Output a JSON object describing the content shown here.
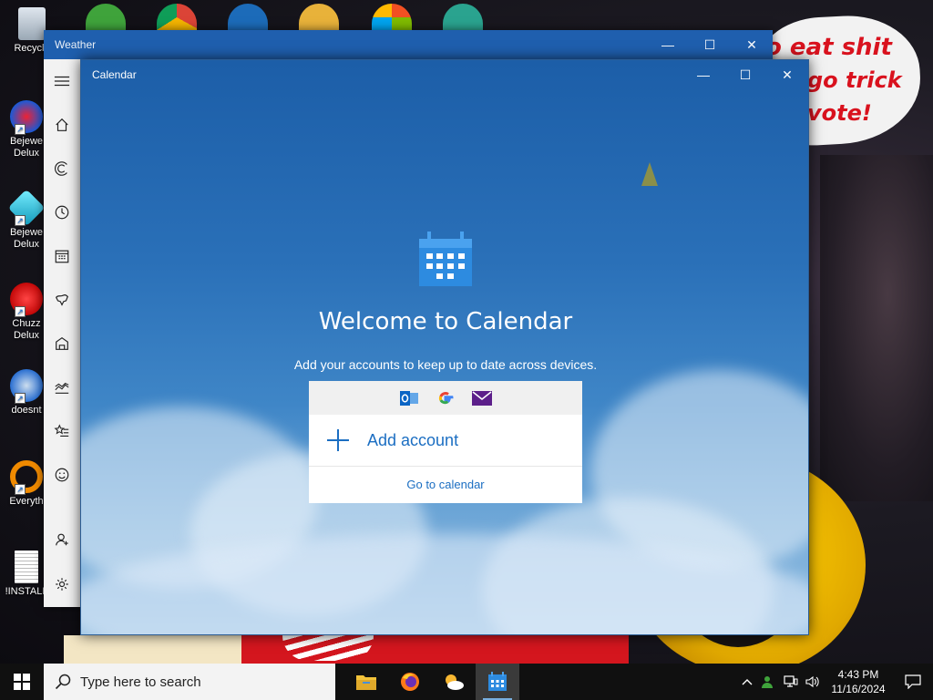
{
  "desktop": {
    "icons": [
      {
        "label": "Recycle"
      },
      {
        "label": "Bejewe Delux"
      },
      {
        "label": "Bejewe Delux"
      },
      {
        "label": "Chuzz Delux"
      },
      {
        "label": "doesnt"
      },
      {
        "label": "Everyth"
      },
      {
        "label": "!INSTALL"
      }
    ],
    "wallpaper_text": [
      "o eat shit",
      "go trick",
      "vote!"
    ]
  },
  "weather_window": {
    "title": "Weather",
    "rail_icons": [
      "hamburger-icon",
      "home-icon",
      "forecast-icon",
      "historical-icon",
      "calendar-grid-icon",
      "maps-icon",
      "ski-resort-icon",
      "historical-chart-icon",
      "favorites-icon",
      "smiley-icon",
      "account-icon",
      "settings-icon"
    ]
  },
  "calendar_window": {
    "title": "Calendar",
    "welcome": "Welcome to Calendar",
    "subtitle": "Add your accounts to keep up to date across devices.",
    "providers": [
      "outlook-icon",
      "google-icon",
      "mail-icon"
    ],
    "add_account": "Add account",
    "go_to_calendar": "Go to calendar"
  },
  "taskbar": {
    "search_placeholder": "Type here to search",
    "apps": [
      "file-explorer-icon",
      "firefox-icon",
      "weather-icon",
      "calendar-icon"
    ],
    "clock_time": "4:43 PM",
    "clock_date": "11/16/2024"
  },
  "colors": {
    "accent": "#1b6ec2",
    "titlebar": "#1f5fae",
    "taskbar": "#101010"
  }
}
